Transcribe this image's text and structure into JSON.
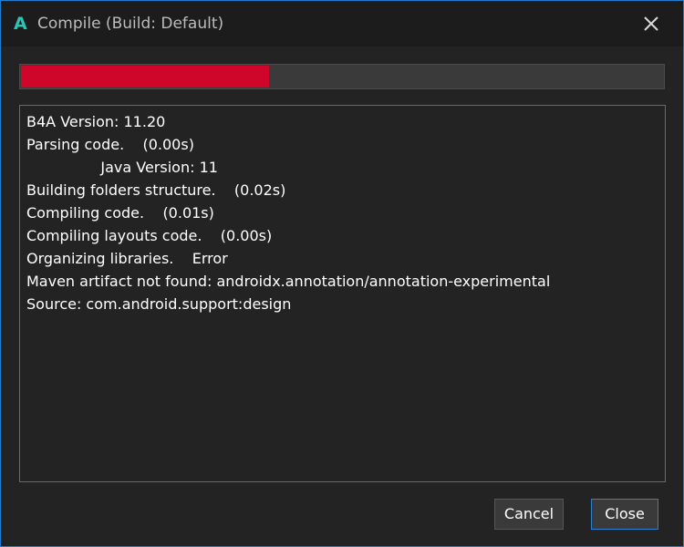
{
  "window": {
    "app_icon_glyph": "A",
    "title": "Compile (Build: Default)",
    "close_icon": "close-icon"
  },
  "progress": {
    "value_fraction": 0.386,
    "fill_color": "#d0052a",
    "track_color": "#3a3a3a"
  },
  "log": {
    "lines": [
      "B4A Version: 11.20",
      "Parsing code.    (0.00s)",
      "                Java Version: 11",
      "Building folders structure.    (0.02s)",
      "Compiling code.    (0.01s)",
      "Compiling layouts code.    (0.00s)",
      "Organizing libraries.    Error",
      "Maven artifact not found: androidx.annotation/annotation-experimental",
      "Source: com.android.support:design"
    ]
  },
  "buttons": {
    "cancel_label": "Cancel",
    "close_label": "Close"
  },
  "colors": {
    "accent": "#1e7ed6",
    "icon": "#2bc4b6",
    "background": "#232323"
  }
}
